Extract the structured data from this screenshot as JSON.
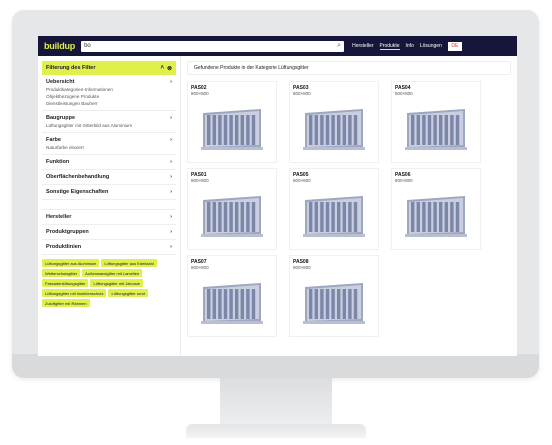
{
  "topbar": {
    "logo": "buildup",
    "search_value": "bo",
    "nav": [
      "Hersteller",
      "Produkte",
      "Info",
      "Lösungen"
    ],
    "lang": "DE"
  },
  "sidebar": {
    "filter_title": "Filterung des Filter",
    "sections": [
      {
        "title": "Uebersicht",
        "lines": [
          "Produktkategorien-Informationen",
          "Objektbezogene Produkte",
          "Dienstleistungen Bauherr"
        ]
      },
      {
        "title": "Baugruppe",
        "lines": [
          "Lüftungsgitter mit Gitterbild aus Aluminium"
        ]
      },
      {
        "title": "Farbe",
        "lines": [
          "Naturfarbe eloxiert"
        ]
      },
      {
        "title": "Funktion",
        "lines": []
      },
      {
        "title": "Oberflächenbehandlung",
        "lines": []
      },
      {
        "title": "Sonstige Eigenschaften",
        "lines": []
      }
    ],
    "sections2": [
      {
        "title": "Hersteller",
        "lines": []
      },
      {
        "title": "Produktgruppen",
        "lines": []
      },
      {
        "title": "Produktlinien",
        "lines": []
      }
    ],
    "chips": [
      "Lüftungsgitter aus Aluminium",
      "Lüftungsgitter aus Edelstahl",
      "Wetterschutzgitter",
      "Außenwandgitter mit Lamellen",
      "Fassadenlüftungsgitter",
      "Lüftungsgitter mit Jalousie",
      "Lüftungsgitter mit Insektenschutz",
      "Lüftungsgitter rund",
      "Zuluftgitter mit Rahmen"
    ]
  },
  "main": {
    "result_text": "Gefundene Produkte in der Kategorie Lüftungsgitter",
    "cards": [
      {
        "title": "PAS02",
        "size": "800×800"
      },
      {
        "title": "PAS03",
        "size": "800×800"
      },
      {
        "title": "PAS04",
        "size": "800×800"
      },
      {
        "title": "PAS01",
        "size": "800×800"
      },
      {
        "title": "PAS05",
        "size": "800×800"
      },
      {
        "title": "PAS06",
        "size": "800×800"
      },
      {
        "title": "PAS07",
        "size": "800×800"
      },
      {
        "title": "PAS08",
        "size": "800×800"
      }
    ]
  }
}
